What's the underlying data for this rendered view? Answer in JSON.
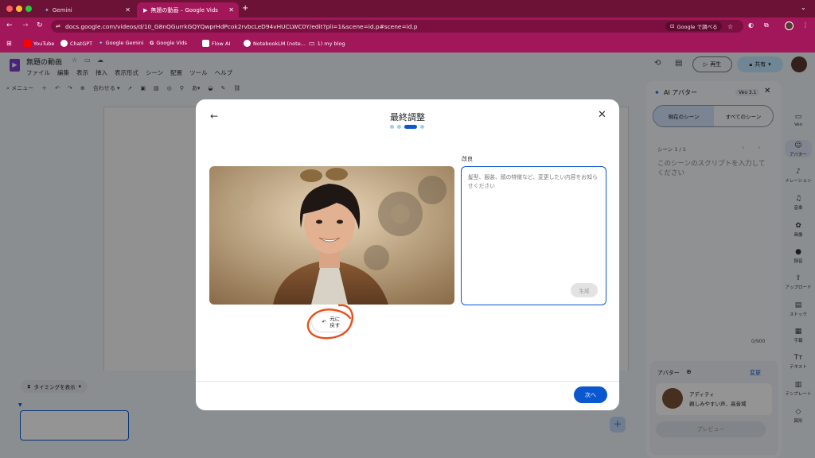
{
  "browser": {
    "tabs": [
      {
        "label": "Gemini",
        "active": false
      },
      {
        "label": "無題の動画 – Google Vids",
        "active": true
      }
    ],
    "new_tab": "+",
    "url": "docs.google.com/videos/d/10_G8nQGurrkGQYQwprHdPcok2rvbcLeD94vHUCLWC0Y/edit?pli=1&scene=id.p#scene=id.p",
    "search_chip": "Google で調べる",
    "bookmarks": [
      "YouTube",
      "ChatGPT",
      "Google Gemini",
      "Google Vids",
      "Flow AI",
      "NotebookLM (note...",
      "1) my blog"
    ]
  },
  "app": {
    "doc_title": "無題の動画",
    "menu": [
      "ファイル",
      "編集",
      "表示",
      "挿入",
      "表示形式",
      "シーン",
      "配置",
      "ツール",
      "ヘルプ"
    ],
    "toolbar": {
      "menu_label": "メニュー",
      "fit_label": "合わせる"
    },
    "play_label": "再生",
    "share_label": "共有",
    "timing_label": "タイミングを表示",
    "right_panel": {
      "title": "AI アバター",
      "version": "Veo 3.1",
      "tab_current": "現在のシーン",
      "tab_all": "すべてのシーン",
      "scene_label": "シーン 1 / 1",
      "script_placeholder": "このシーンのスクリプトを入力してください",
      "char_count": "0/900",
      "avatar_section": "アバター",
      "change_label": "変更",
      "avatar_name": "アディティ",
      "avatar_desc": "親しみやすい声、高音域",
      "preview_label": "プレビュー"
    },
    "rail": [
      {
        "icon": "film-icon",
        "label": "Veo"
      },
      {
        "icon": "avatar-icon",
        "label": "アバター"
      },
      {
        "icon": "narration-icon",
        "label": "ナレーション"
      },
      {
        "icon": "music-icon",
        "label": "音楽"
      },
      {
        "icon": "image-icon",
        "label": "画像"
      },
      {
        "icon": "record-icon",
        "label": "録音"
      },
      {
        "icon": "upload-icon",
        "label": "アップロード"
      },
      {
        "icon": "stock-icon",
        "label": "ストック"
      },
      {
        "icon": "caption-icon",
        "label": "字幕"
      },
      {
        "icon": "text-icon",
        "label": "テキスト"
      },
      {
        "icon": "template-icon",
        "label": "テンプレート"
      },
      {
        "icon": "shape-icon",
        "label": "図形"
      }
    ]
  },
  "dialog": {
    "title": "最終調整",
    "steps": 4,
    "active_step": 3,
    "improve_label": "改良",
    "improve_placeholder": "髪型、服装、顔の特徴など、変更したい内容をお知らせください",
    "generate_label": "生成",
    "revert_label": "元に戻す",
    "next_label": "次へ"
  },
  "colors": {
    "chrome": "#a1175a",
    "primary": "#0b57d0",
    "highlight_circle": "#e8501a"
  }
}
